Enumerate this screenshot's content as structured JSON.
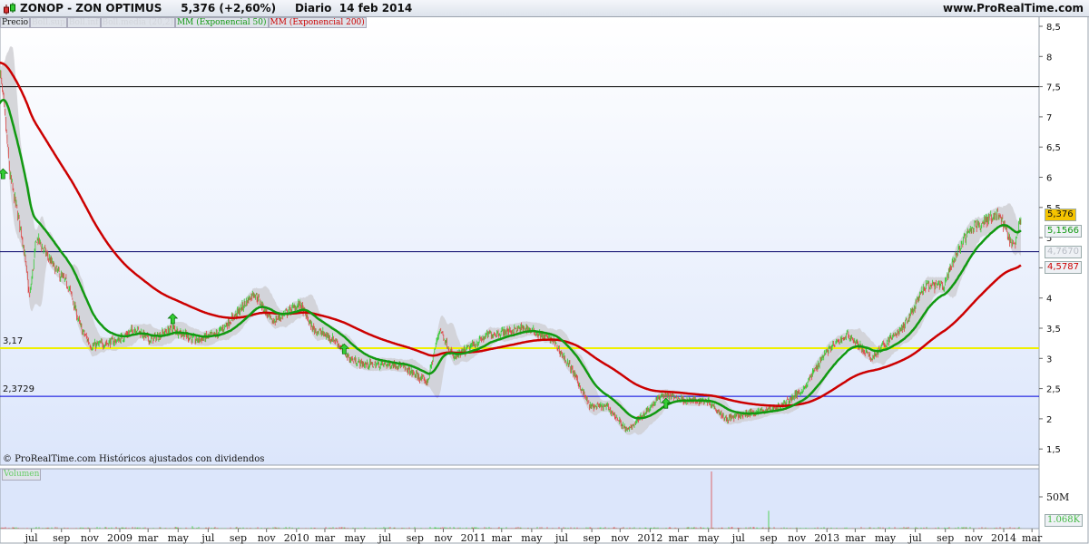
{
  "header": {
    "symbol": "ZONOP - ZON OPTIMUS",
    "last": "5,376 (+2,60%)",
    "period": "Diario",
    "date": "14 feb 2014",
    "site": "www.ProRealTime.com"
  },
  "legend": [
    "Precio",
    "Boll.sup",
    "Boll.inf",
    "Boll.media (20,2)",
    "MM (Exponencial 50)",
    "MM (Exponencial 200)"
  ],
  "footer_note": "© ProRealTime.com  Históricos ajustados con dividendos",
  "volume_label": "Volumen",
  "horizontal_lines": [
    {
      "value": 7.5,
      "color": "#000000",
      "label": ""
    },
    {
      "value": 4.767,
      "color": "#000066",
      "label": ""
    },
    {
      "value": 3.17,
      "color": "#f0f000",
      "label": "3,17"
    },
    {
      "value": 2.3729,
      "color": "#0000dd",
      "label": "2,3729"
    }
  ],
  "price_tags": [
    {
      "text": "5,376",
      "value": 5.376,
      "color": "#111111",
      "bg": "#f5c400"
    },
    {
      "text": "5,1566",
      "value": 5.1566,
      "color": "#119911",
      "bg": "#eef1f5"
    },
    {
      "text": "4,7670",
      "value": 4.767,
      "color": "#b8bcc4",
      "bg": "#eef1f5"
    },
    {
      "text": "4,5787",
      "value": 4.5787,
      "color": "#cc0000",
      "bg": "#eef1f5"
    }
  ],
  "volume_tags": [
    {
      "text": "1.068K",
      "color": "#44bb44"
    }
  ],
  "colors": {
    "up": "#33cc33",
    "down": "#dd4444",
    "ema50": "#119911",
    "ema200": "#cc0000",
    "band": "#cfcfd4",
    "bg_top": "#ffffff",
    "bg_bottom": "#dce6fb"
  },
  "chart_data": {
    "type": "candlestick",
    "title": "ZONOP - ZON OPTIMUS Diario",
    "ylim": [
      1.3,
      8.6
    ],
    "yticks": [
      1.5,
      2,
      2.5,
      3,
      3.5,
      4,
      4.5,
      5,
      5.5,
      6,
      6.5,
      7,
      7.5,
      8,
      8.5
    ],
    "ytick_labels": [
      "1,5",
      "2",
      "2,5",
      "3",
      "3,5",
      "4",
      "4,5",
      "5",
      "5,5",
      "6",
      "6,5",
      "7",
      "7,5",
      "8",
      "8,5"
    ],
    "xlim_year": [
      2008.34,
      2014.22
    ],
    "xticks": [
      {
        "t": 2008.5,
        "label": "jul"
      },
      {
        "t": 2008.67,
        "label": "sep"
      },
      {
        "t": 2008.83,
        "label": "nov"
      },
      {
        "t": 2009.0,
        "label": "2009"
      },
      {
        "t": 2009.16,
        "label": "mar"
      },
      {
        "t": 2009.33,
        "label": "may"
      },
      {
        "t": 2009.5,
        "label": "jul"
      },
      {
        "t": 2009.67,
        "label": "sep"
      },
      {
        "t": 2009.83,
        "label": "nov"
      },
      {
        "t": 2010.0,
        "label": "2010"
      },
      {
        "t": 2010.16,
        "label": "mar"
      },
      {
        "t": 2010.33,
        "label": "may"
      },
      {
        "t": 2010.5,
        "label": "jul"
      },
      {
        "t": 2010.67,
        "label": "sep"
      },
      {
        "t": 2010.83,
        "label": "nov"
      },
      {
        "t": 2011.0,
        "label": "2011"
      },
      {
        "t": 2011.16,
        "label": "mar"
      },
      {
        "t": 2011.33,
        "label": "may"
      },
      {
        "t": 2011.5,
        "label": "jul"
      },
      {
        "t": 2011.67,
        "label": "sep"
      },
      {
        "t": 2011.83,
        "label": "nov"
      },
      {
        "t": 2012.0,
        "label": "2012"
      },
      {
        "t": 2012.16,
        "label": "mar"
      },
      {
        "t": 2012.33,
        "label": "may"
      },
      {
        "t": 2012.5,
        "label": "jul"
      },
      {
        "t": 2012.67,
        "label": "sep"
      },
      {
        "t": 2012.83,
        "label": "nov"
      },
      {
        "t": 2013.0,
        "label": "2013"
      },
      {
        "t": 2013.16,
        "label": "mar"
      },
      {
        "t": 2013.33,
        "label": "may"
      },
      {
        "t": 2013.5,
        "label": "jul"
      },
      {
        "t": 2013.67,
        "label": "sep"
      },
      {
        "t": 2013.83,
        "label": "nov"
      },
      {
        "t": 2014.0,
        "label": "2014"
      },
      {
        "t": 2014.16,
        "label": "mar"
      }
    ],
    "price_keypoints": [
      [
        2008.34,
        7.8
      ],
      [
        2008.37,
        7.0
      ],
      [
        2008.4,
        6.0
      ],
      [
        2008.47,
        5.0
      ],
      [
        2008.51,
        4.0
      ],
      [
        2008.55,
        5.0
      ],
      [
        2008.65,
        4.5
      ],
      [
        2008.73,
        4.2
      ],
      [
        2008.8,
        3.5
      ],
      [
        2008.86,
        3.2
      ],
      [
        2009.01,
        3.3
      ],
      [
        2009.11,
        3.5
      ],
      [
        2009.19,
        3.3
      ],
      [
        2009.32,
        3.5
      ],
      [
        2009.45,
        3.3
      ],
      [
        2009.57,
        3.4
      ],
      [
        2009.7,
        3.8
      ],
      [
        2009.78,
        4.1
      ],
      [
        2009.88,
        3.6
      ],
      [
        2010.04,
        3.9
      ],
      [
        2010.11,
        3.5
      ],
      [
        2010.24,
        3.3
      ],
      [
        2010.32,
        3.0
      ],
      [
        2010.4,
        2.9
      ],
      [
        2010.6,
        2.9
      ],
      [
        2010.76,
        2.6
      ],
      [
        2010.83,
        3.5
      ],
      [
        2010.91,
        3.0
      ],
      [
        2011.01,
        3.2
      ],
      [
        2011.11,
        3.4
      ],
      [
        2011.32,
        3.5
      ],
      [
        2011.47,
        3.3
      ],
      [
        2011.58,
        2.8
      ],
      [
        2011.68,
        2.2
      ],
      [
        2011.78,
        2.2
      ],
      [
        2011.89,
        1.8
      ],
      [
        2011.99,
        2.1
      ],
      [
        2012.09,
        2.4
      ],
      [
        2012.24,
        2.3
      ],
      [
        2012.35,
        2.3
      ],
      [
        2012.45,
        2.0
      ],
      [
        2012.6,
        2.1
      ],
      [
        2012.76,
        2.2
      ],
      [
        2012.89,
        2.5
      ],
      [
        2013.01,
        3.1
      ],
      [
        2013.14,
        3.4
      ],
      [
        2013.27,
        3.0
      ],
      [
        2013.37,
        3.3
      ],
      [
        2013.45,
        3.5
      ],
      [
        2013.58,
        4.2
      ],
      [
        2013.68,
        4.2
      ],
      [
        2013.78,
        4.9
      ],
      [
        2013.86,
        5.2
      ],
      [
        2013.99,
        5.4
      ],
      [
        2014.08,
        4.8
      ],
      [
        2014.12,
        5.376
      ]
    ],
    "ema_start": {
      "ema50": 7.2,
      "ema200": 7.9
    },
    "signals": [
      {
        "t": 2008.36,
        "price": 6.05
      },
      {
        "t": 2009.32,
        "price": 3.65
      },
      {
        "t": 2010.29,
        "price": 3.15
      },
      {
        "t": 2012.11,
        "price": 2.25
      }
    ],
    "volume": {
      "ylim_millions": [
        0,
        100
      ],
      "yticks": [
        {
          "v": 50,
          "label": "50M"
        }
      ],
      "spikes": [
        [
          2012.37,
          90,
          "down"
        ],
        [
          2012.69,
          28,
          "up"
        ],
        [
          2009.43,
          4,
          "up"
        ]
      ]
    }
  }
}
